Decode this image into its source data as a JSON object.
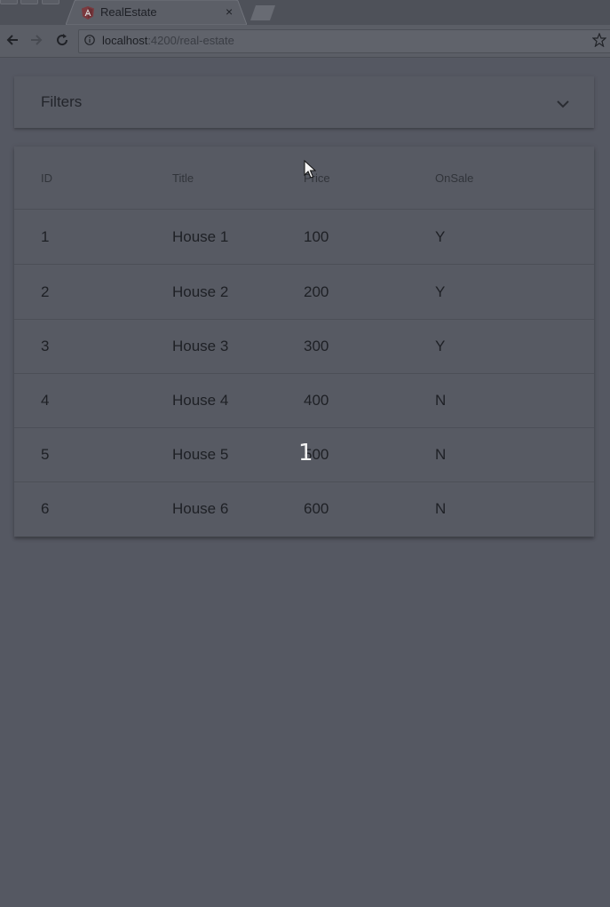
{
  "browser": {
    "tab_title": "RealEstate",
    "tab_close": "×",
    "url_host": "localhost",
    "url_path": ":4200/real-estate",
    "icons": [
      "back-arrow-icon",
      "forward-arrow-icon",
      "reload-icon",
      "info-icon",
      "star-icon",
      "angular-favicon-icon"
    ]
  },
  "filters": {
    "title": "Filters",
    "expand_icon": "chevron-down-icon"
  },
  "table": {
    "headers": [
      "ID",
      "Title",
      "Price",
      "OnSale"
    ],
    "rows": [
      [
        "1",
        "House 1",
        "100",
        "Y"
      ],
      [
        "2",
        "House 2",
        "200",
        "Y"
      ],
      [
        "3",
        "House 3",
        "300",
        "Y"
      ],
      [
        "4",
        "House 4",
        "400",
        "N"
      ],
      [
        "5",
        "House 5",
        "500",
        "N"
      ],
      [
        "6",
        "House 6",
        "600",
        "N"
      ]
    ]
  },
  "overlay": {
    "digit": "1"
  },
  "colors": {
    "page_background": "#555862",
    "card_background": "#575a63"
  }
}
